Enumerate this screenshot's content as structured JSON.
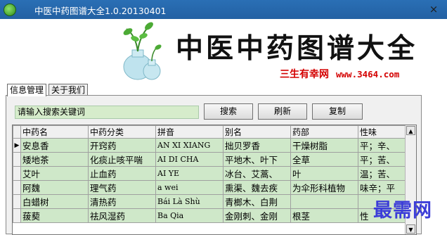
{
  "window": {
    "title": "中医中药图谱大全1.0.20130401",
    "close_glyph": "×"
  },
  "banner": {
    "title": "中医中药图谱大全",
    "subtitle": "三生有幸网",
    "url": "www.3464.com"
  },
  "tabs": [
    {
      "label": "信息管理",
      "active": true
    },
    {
      "label": "关于我们",
      "active": false
    }
  ],
  "search": {
    "value": "请输入搜索关键词"
  },
  "buttons": {
    "search": "搜索",
    "refresh": "刷新",
    "copy": "复制"
  },
  "table": {
    "columns": [
      "中药名",
      "中药分类",
      "拼音",
      "别名",
      "药部",
      "性味"
    ],
    "current_row_marker": "▶",
    "rows": [
      [
        "安息香",
        "开窍药",
        "AN XI XIANG",
        "拙贝罗香",
        "干燥树脂",
        "平；辛、"
      ],
      [
        "矮地茶",
        "化痰止咳平喘",
        "AI DI CHA",
        "平地木、叶下",
        "全草",
        "平；苦、"
      ],
      [
        "艾叶",
        "止血药",
        "AI YE",
        "冰台、艾蒿、",
        "叶",
        "温；苦、"
      ],
      [
        "阿魏",
        "理气药",
        "a wei",
        "熏渠、魏去疾",
        "为伞形科植物",
        "味辛；平"
      ],
      [
        "白蜡树",
        "清热药",
        "Bái Là Shù",
        "青榔木、白荆",
        "",
        ""
      ],
      [
        "菝葜",
        "祛风湿药",
        "Ba Qia",
        "金刚刺、金刚",
        "根茎",
        "性"
      ]
    ]
  },
  "watermark": "最需网",
  "colors": {
    "titlebar": "#2361a3",
    "banner_title": "#111111",
    "banner_subtitle": "#d40000",
    "row_background": "#cfe8c9",
    "search_background": "#d6eccb",
    "watermark": "#3c3dd8"
  }
}
